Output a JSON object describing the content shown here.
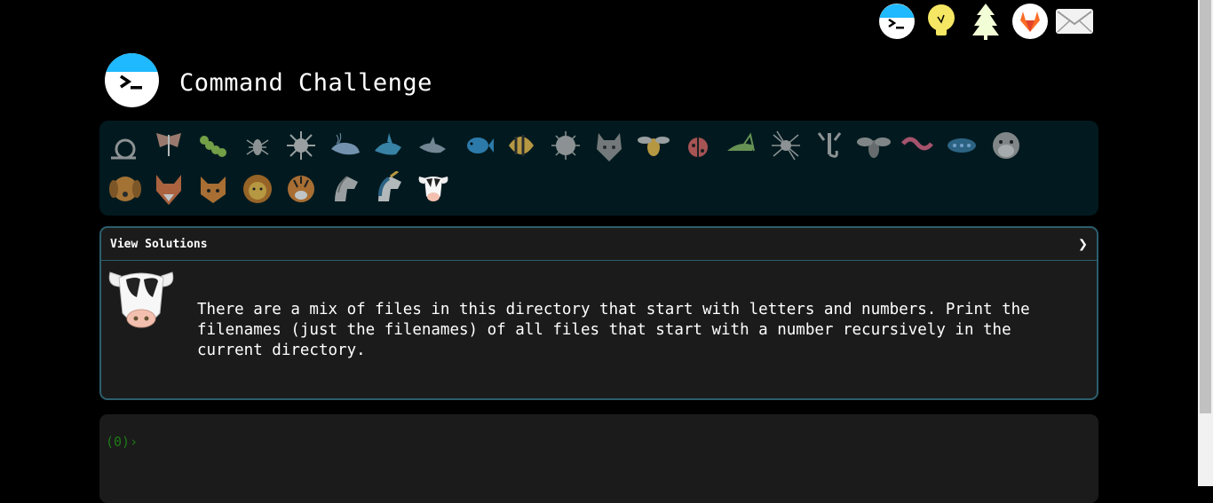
{
  "header": {
    "title": "Command Challenge"
  },
  "topnav": [
    {
      "icon": "terminal-icon"
    },
    {
      "icon": "lightbulb-icon"
    },
    {
      "icon": "tree-icon"
    },
    {
      "icon": "gitlab-icon"
    },
    {
      "icon": "mail-icon"
    }
  ],
  "levels": [
    {
      "icon": "snail-icon"
    },
    {
      "icon": "moth-icon"
    },
    {
      "icon": "caterpillar-icon"
    },
    {
      "icon": "ant-icon"
    },
    {
      "icon": "sea-urchin-icon"
    },
    {
      "icon": "whale-icon"
    },
    {
      "icon": "shark-icon"
    },
    {
      "icon": "dolphin-icon"
    },
    {
      "icon": "fish-icon"
    },
    {
      "icon": "angelfish-icon"
    },
    {
      "icon": "pufferfish-icon"
    },
    {
      "icon": "wolf-icon"
    },
    {
      "icon": "bee-icon"
    },
    {
      "icon": "ladybug-icon"
    },
    {
      "icon": "grasshopper-icon"
    },
    {
      "icon": "spider-icon"
    },
    {
      "icon": "scorpion-icon"
    },
    {
      "icon": "fly-icon"
    },
    {
      "icon": "worm-icon"
    },
    {
      "icon": "bacteria-icon"
    },
    {
      "icon": "monkey-icon"
    },
    {
      "icon": "dog-icon"
    },
    {
      "icon": "fox-icon"
    },
    {
      "icon": "cat-icon"
    },
    {
      "icon": "lion-icon"
    },
    {
      "icon": "tiger-icon"
    },
    {
      "icon": "horse-icon"
    },
    {
      "icon": "unicorn-icon"
    },
    {
      "icon": "cow-icon"
    }
  ],
  "panel": {
    "header_label": "View Solutions",
    "toggle_icon": "chevron-right-icon",
    "description": "There are a mix of files in this directory that start with letters and numbers. Print the filenames (just the filenames) of all files that start with a number recursively in the current directory."
  },
  "terminal": {
    "prompt": "(0)›"
  },
  "colors": {
    "level_bar_bg": "#021a1f",
    "panel_border": "#2c5f6c",
    "prompt": "#1e7a17",
    "logo_accent": "#1eb9ff"
  }
}
